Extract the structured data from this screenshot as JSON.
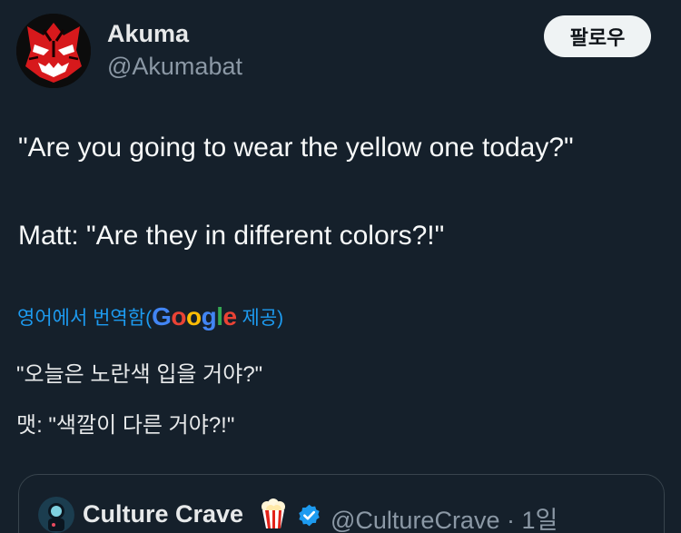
{
  "author": {
    "display_name": "Akuma",
    "handle": "@Akumabat",
    "avatar_icon": "red-demon-mask-avatar"
  },
  "follow_button": {
    "label": "팔로우"
  },
  "tweet": {
    "lines": [
      "\"Are you going to wear the yellow one today?\"",
      "Matt: \"Are they in different colors?!\""
    ]
  },
  "translation": {
    "prefix": "영어에서 번역함(",
    "provider": "Google",
    "suffix": " 제공)",
    "lines": [
      "\"오늘은 노란색 입을 거야?\"",
      "맷: \"색깔이 다른 거야?!\""
    ]
  },
  "quoted_tweet": {
    "display_name": "Culture Crave",
    "emoji_icon": "popcorn-icon",
    "verified_icon": "verified-badge-icon",
    "handle_time": "@CultureCrave · 1일"
  },
  "colors": {
    "background": "#15202b",
    "link": "#1d9bf0",
    "muted": "#8b98a5",
    "verified": "#1d9bf0"
  }
}
